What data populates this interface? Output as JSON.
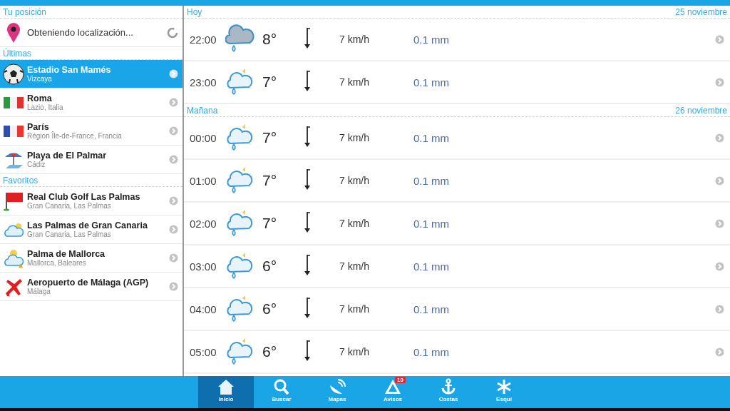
{
  "sidebar": {
    "sections": [
      {
        "title": "Tu posición",
        "items": [
          {
            "kind": "pin",
            "name": "Obteniendo localización...",
            "loading": true,
            "selected": false
          }
        ]
      },
      {
        "title": "Últimas",
        "items": [
          {
            "kind": "ball",
            "name": "Estadio San Mamés",
            "sub": "Vizcaya",
            "selected": true
          },
          {
            "kind": "italy",
            "name": "Roma",
            "sub": "Lazio, Italia",
            "selected": false
          },
          {
            "kind": "france",
            "name": "París",
            "sub": "Région Île-de-France, Francia",
            "selected": false
          },
          {
            "kind": "beach",
            "name": "Playa de El Palmar",
            "sub": "Cádiz",
            "selected": false
          }
        ]
      },
      {
        "title": "Favoritos",
        "items": [
          {
            "kind": "golf",
            "name": "Real Club Golf Las Palmas",
            "sub": "Gran Canaria, Las Palmas",
            "selected": false
          },
          {
            "kind": "cloud",
            "name": "Las Palmas de Gran Canaria",
            "sub": "Gran Canaria, Las Palmas",
            "selected": false
          },
          {
            "kind": "cloudsun",
            "name": "Palma de Mallorca",
            "sub": "Mallorca, Baleares",
            "selected": false
          },
          {
            "kind": "plane",
            "name": "Aeropuerto de Málaga (AGP)",
            "sub": "Málaga",
            "selected": false
          }
        ]
      }
    ]
  },
  "forecast": {
    "days": [
      {
        "title": "Hoy",
        "date": "25 noviembre",
        "hours": [
          {
            "time": "22:00",
            "kind": "rain",
            "temp": "8°",
            "wind": "7 km/h",
            "rain": "0.1 mm"
          },
          {
            "time": "23:00",
            "kind": "sunrain",
            "temp": "7°",
            "wind": "7 km/h",
            "rain": "0.1 mm"
          }
        ]
      },
      {
        "title": "Mañana",
        "date": "26 noviembre",
        "hours": [
          {
            "time": "00:00",
            "kind": "sunrain",
            "temp": "7°",
            "wind": "7 km/h",
            "rain": "0.1 mm"
          },
          {
            "time": "01:00",
            "kind": "sunrain",
            "temp": "7°",
            "wind": "7 km/h",
            "rain": "0.1 mm"
          },
          {
            "time": "02:00",
            "kind": "sunrain",
            "temp": "7°",
            "wind": "7 km/h",
            "rain": "0.1 mm"
          },
          {
            "time": "03:00",
            "kind": "sunrain",
            "temp": "6°",
            "wind": "7 km/h",
            "rain": "0.1 mm"
          },
          {
            "time": "04:00",
            "kind": "sunrain",
            "temp": "6°",
            "wind": "7 km/h",
            "rain": "0.1 mm"
          },
          {
            "time": "05:00",
            "kind": "sunrain",
            "temp": "6°",
            "wind": "7 km/h",
            "rain": "0.1 mm"
          }
        ]
      }
    ]
  },
  "bottom_nav": [
    {
      "kind": "home",
      "label": "Inicio",
      "selected": true
    },
    {
      "kind": "search",
      "label": "Buscar",
      "selected": false
    },
    {
      "kind": "dish",
      "label": "Mapas",
      "selected": false
    },
    {
      "kind": "warning",
      "label": "Avisos",
      "selected": false,
      "badge": "10"
    },
    {
      "kind": "anchor",
      "label": "Costas",
      "selected": false
    },
    {
      "kind": "snow",
      "label": "Esquí",
      "selected": false
    }
  ]
}
